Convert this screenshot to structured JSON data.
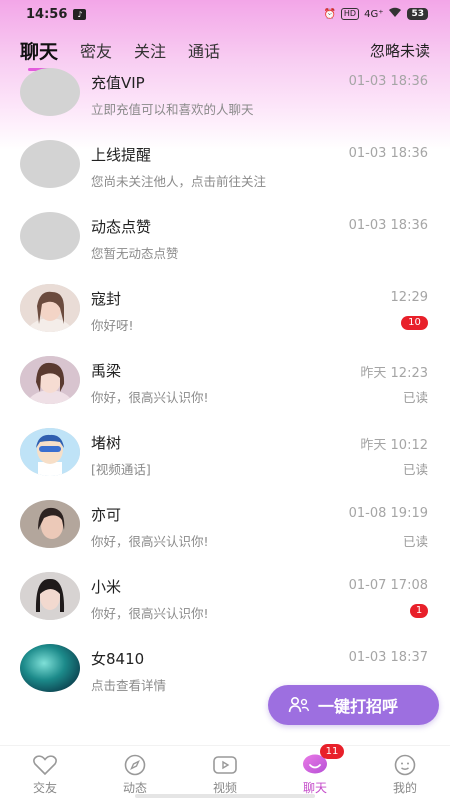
{
  "status_bar": {
    "time": "14:56",
    "app_badge": "♪",
    "hd": "HD",
    "signal": "4G⁺",
    "battery": "53"
  },
  "tabs": [
    {
      "label": "聊天",
      "active": true
    },
    {
      "label": "密友",
      "active": false
    },
    {
      "label": "关注",
      "active": false
    },
    {
      "label": "通话",
      "active": false
    }
  ],
  "ignore_unread": "忽略未读",
  "conversations": [
    {
      "name": "充值VIP",
      "preview": "立即充值可以和喜欢的人聊天",
      "time": "01-03 18:36",
      "status": "",
      "badge": ""
    },
    {
      "name": "上线提醒",
      "preview": "您尚未关注他人，点击前往关注",
      "time": "01-03 18:36",
      "status": "",
      "badge": ""
    },
    {
      "name": "动态点赞",
      "preview": "您暂无动态点赞",
      "time": "01-03 18:36",
      "status": "",
      "badge": ""
    },
    {
      "name": "寇封",
      "preview": "你好呀!",
      "time": "12:29",
      "status": "",
      "badge": "10"
    },
    {
      "name": "禹梁",
      "preview": "你好，很高兴认识你!",
      "time": "昨天 12:23",
      "status": "已读",
      "badge": ""
    },
    {
      "name": "堵树",
      "preview": "[视频通话]",
      "time": "昨天 10:12",
      "status": "已读",
      "badge": ""
    },
    {
      "name": "亦可",
      "preview": "你好，很高兴认识你!",
      "time": "01-08 19:19",
      "status": "已读",
      "badge": ""
    },
    {
      "name": "小米",
      "preview": "你好，很高兴认识你!",
      "time": "01-07 17:08",
      "status": "",
      "badge": "1"
    },
    {
      "name": "女8410",
      "preview": "点击查看详情",
      "time": "01-03 18:37",
      "status": "",
      "badge": ""
    }
  ],
  "greet_button": {
    "label": "一键打招呼",
    "icon": "people-icon",
    "color": "#9d6fe0"
  },
  "bottom_nav": [
    {
      "label": "交友",
      "icon": "heart-icon",
      "active": false
    },
    {
      "label": "动态",
      "icon": "compass-icon",
      "active": false
    },
    {
      "label": "视频",
      "icon": "video-icon",
      "active": false
    },
    {
      "label": "聊天",
      "icon": "chat-bubble-icon",
      "active": true,
      "badge": "11"
    },
    {
      "label": "我的",
      "icon": "smile-icon",
      "active": false
    }
  ],
  "colors": {
    "accent": "#e35bdd",
    "badge": "#e8202a",
    "nav_active": "#c44ac9"
  }
}
